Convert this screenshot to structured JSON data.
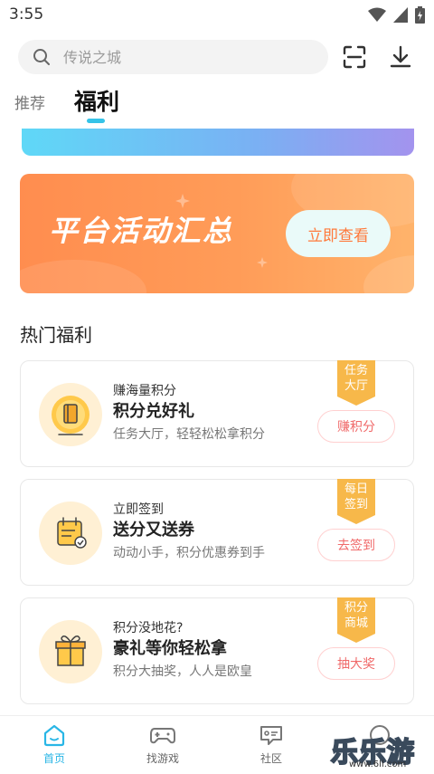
{
  "status_bar": {
    "time": "3:55"
  },
  "search": {
    "placeholder": "传说之城"
  },
  "tabs": [
    {
      "label": "推荐"
    },
    {
      "label": "福利"
    }
  ],
  "banner": {
    "title": "平台活动汇总",
    "button": "立即查看"
  },
  "section": {
    "title": "热门福利"
  },
  "cards": [
    {
      "small": "赚海量积分",
      "title": "积分兑好礼",
      "desc": "任务大厅，轻轻松松拿积分",
      "button": "赚积分",
      "ribbon": [
        "任务",
        "大厅"
      ],
      "icon": "book-coin-icon"
    },
    {
      "small": "立即签到",
      "title": "送分又送券",
      "desc": "动动小手，积分优惠券到手",
      "button": "去签到",
      "ribbon": [
        "每日",
        "签到"
      ],
      "icon": "calendar-check-icon"
    },
    {
      "small": "积分没地花?",
      "title": "豪礼等你轻松拿",
      "desc": "积分大抽奖，人人是欧皇",
      "button": "抽大奖",
      "ribbon": [
        "积分",
        "商城"
      ],
      "icon": "gift-box-icon"
    }
  ],
  "bottom_nav": [
    {
      "label": "首页",
      "icon": "home-icon"
    },
    {
      "label": "找游戏",
      "icon": "gamepad-icon"
    },
    {
      "label": "社区",
      "icon": "community-icon"
    },
    {
      "label": "",
      "icon": "user-icon"
    }
  ],
  "watermark": {
    "text": "乐乐游戏",
    "url": "www.6ll.com"
  },
  "colors": {
    "accent": "#29b6e6",
    "banner_orange": "#ff8d4f",
    "ribbon": "#f7b84a",
    "button_text": "#f06a6a"
  }
}
